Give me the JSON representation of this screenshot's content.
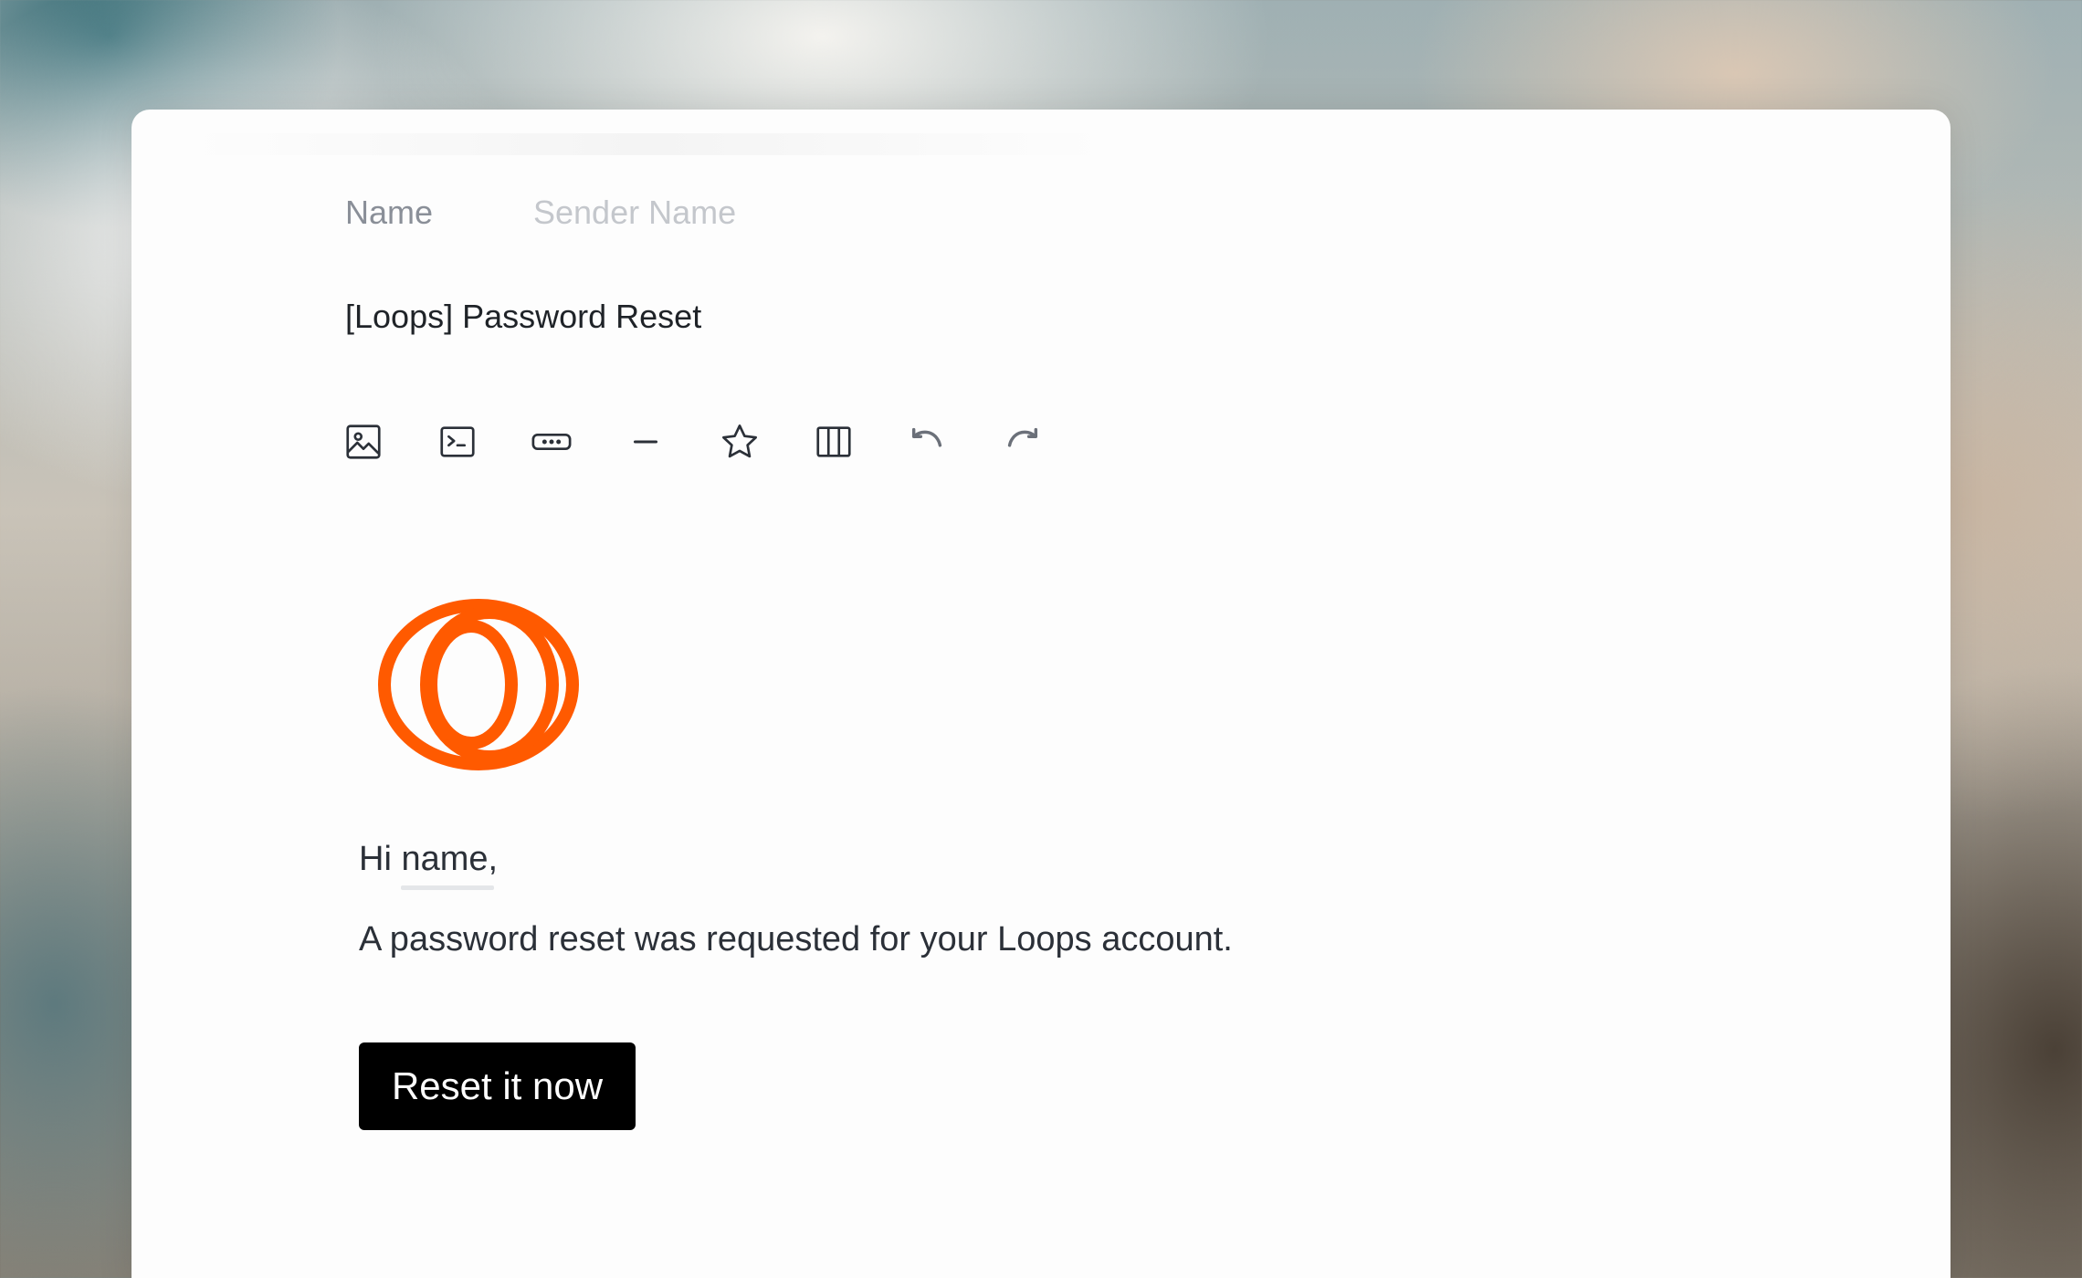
{
  "sender": {
    "name_label": "Name",
    "name_placeholder": "Sender Name"
  },
  "subject": "[Loops] Password Reset",
  "toolbar": {
    "items": [
      {
        "icon": "image-icon"
      },
      {
        "icon": "code-block-icon"
      },
      {
        "icon": "button-icon"
      },
      {
        "icon": "divider-icon"
      },
      {
        "icon": "star-icon"
      },
      {
        "icon": "columns-icon"
      },
      {
        "icon": "undo-icon"
      },
      {
        "icon": "redo-icon"
      }
    ]
  },
  "email": {
    "logo": "loops-logo",
    "greeting_prefix": "Hi ",
    "greeting_variable": "name",
    "greeting_suffix": ",",
    "body": "A password reset was requested for your Loops account.",
    "cta_label": "Reset it now"
  },
  "colors": {
    "brand_orange": "#ff5a00",
    "cta_background": "#000000",
    "cta_text": "#ffffff"
  }
}
